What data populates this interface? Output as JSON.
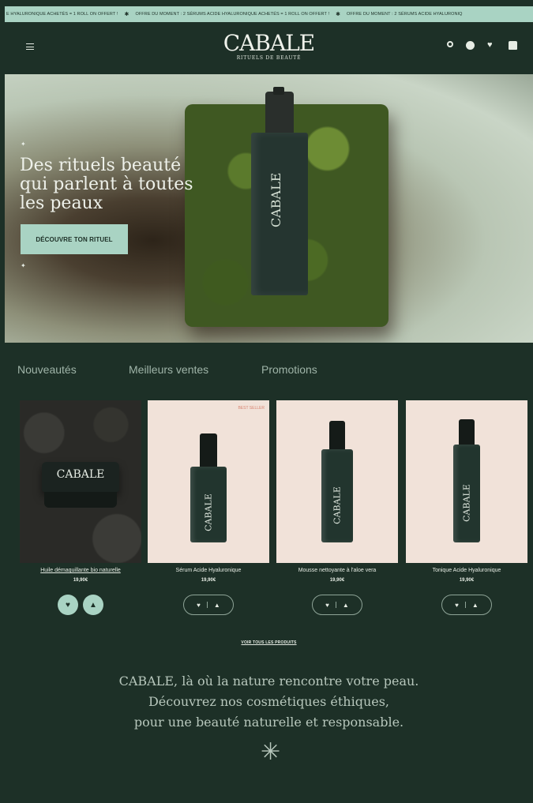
{
  "promo_bar": {
    "items": [
      "E HYALURONIQUE ACHETÉS = 1 ROLL ON OFFERT !",
      "OFFRE DU MOMENT : 2 SÉRUMS ACIDE HYALURONIQUE ACHETÉS = 1 ROLL ON OFFERT !",
      "OFFRE DU MOMENT : 2 SÉRUMS ACIDE HYALURONIQ"
    ],
    "separator": "✱"
  },
  "header": {
    "brand": "CABALE",
    "tagline": "RITUELS DE BEAUTÉ",
    "icons": [
      "menu-icon",
      "search-icon",
      "account-icon",
      "heart-icon",
      "bag-icon"
    ]
  },
  "hero": {
    "title": "Des rituels beauté qui parlent à toutes les peaux",
    "cta": "DÉCOUVRE TON RITUEL",
    "bottle_label": "CABALE"
  },
  "tabs": [
    "Nouveautés",
    "Meilleurs ventes",
    "Promotions"
  ],
  "products": [
    {
      "name": "Huile démaquillante bio naturelle",
      "price": "19,90€",
      "badge": "",
      "label": "CABALE"
    },
    {
      "name": "Sérum Acide Hyaluronique",
      "price": "19,90€",
      "badge": "BEST SELLER",
      "label": "CABALE"
    },
    {
      "name": "Mousse nettoyante à l'aloe vera",
      "price": "19,90€",
      "badge": "",
      "label": "CABALE"
    },
    {
      "name": "Tonique Acide Hyaluronique",
      "price": "19,90€",
      "badge": "",
      "label": "CABALE"
    }
  ],
  "see_all": "VOIR TOUS LES PRODUITS",
  "tagline": {
    "line1": "CABALE, là où la nature rencontre votre peau.",
    "line2": "Découvrez nos cosmétiques éthiques,",
    "line3": "pour une beauté naturelle et responsable."
  },
  "colors": {
    "background": "#1d3027",
    "accent": "#a9d3c3",
    "card_bg": "#f1e2d9",
    "badge": "#d98471"
  }
}
